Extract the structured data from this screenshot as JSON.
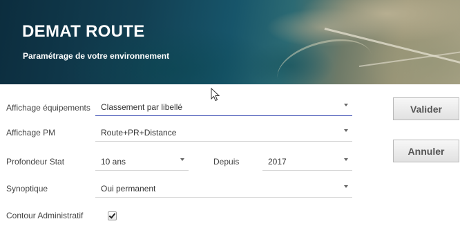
{
  "header": {
    "title": "DEMAT ROUTE",
    "subtitle": "Paramétrage de votre environnement"
  },
  "form": {
    "equipements": {
      "label": "Affichage équipements",
      "value": "Classement par libellé"
    },
    "pm": {
      "label": "Affichage PM",
      "value": "Route+PR+Distance"
    },
    "profondeur": {
      "label": "Profondeur Stat",
      "value": "10 ans"
    },
    "depuis": {
      "label": "Depuis",
      "value": "2017"
    },
    "synoptique": {
      "label": "Synoptique",
      "value": "Oui permanent"
    },
    "contour": {
      "label": "Contour Administratif",
      "checked": true
    }
  },
  "actions": {
    "validate_label": "Valider",
    "cancel_label": "Annuler"
  },
  "colors": {
    "focus_underline": "#3f51b5",
    "button_text": "#555555"
  }
}
